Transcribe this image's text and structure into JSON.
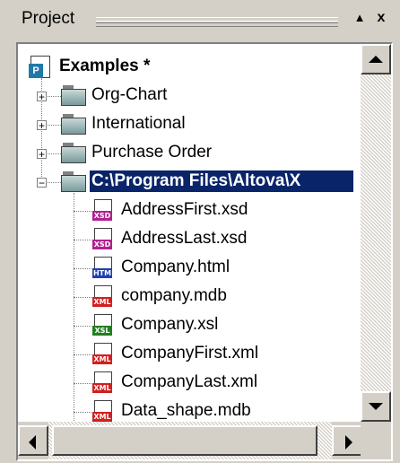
{
  "window": {
    "title": "Project",
    "pin_button": "▲",
    "close_button": "x"
  },
  "tree": {
    "root": {
      "label": "Examples *",
      "icon": "project-icon"
    },
    "folders": [
      {
        "label": "Org-Chart",
        "expander": "+",
        "icon": "folder-icon"
      },
      {
        "label": "International",
        "expander": "+",
        "icon": "folder-icon"
      },
      {
        "label": "Purchase Order",
        "expander": "+",
        "icon": "folder-icon"
      },
      {
        "label": "C:\\Program Files\\Altova\\X",
        "expander": "−",
        "icon": "folder-icon",
        "selected": true
      }
    ],
    "files": [
      {
        "label": "AddressFirst.xsd",
        "badge": "XSD",
        "badge_color": "#b0208f"
      },
      {
        "label": "AddressLast.xsd",
        "badge": "XSD",
        "badge_color": "#b0208f"
      },
      {
        "label": "Company.html",
        "badge": "HTM",
        "badge_color": "#1f3fb0"
      },
      {
        "label": "company.mdb",
        "badge": "XML",
        "badge_color": "#d02020"
      },
      {
        "label": "Company.xsl",
        "badge": "XSL",
        "badge_color": "#208020"
      },
      {
        "label": "CompanyFirst.xml",
        "badge": "XML",
        "badge_color": "#d02020"
      },
      {
        "label": "CompanyLast.xml",
        "badge": "XML",
        "badge_color": "#d02020"
      },
      {
        "label": "Data_shape.mdb",
        "badge": "XML",
        "badge_color": "#d02020"
      }
    ]
  },
  "colors": {
    "selection_bg": "#0a246a",
    "panel_bg": "#d4d0c8"
  }
}
